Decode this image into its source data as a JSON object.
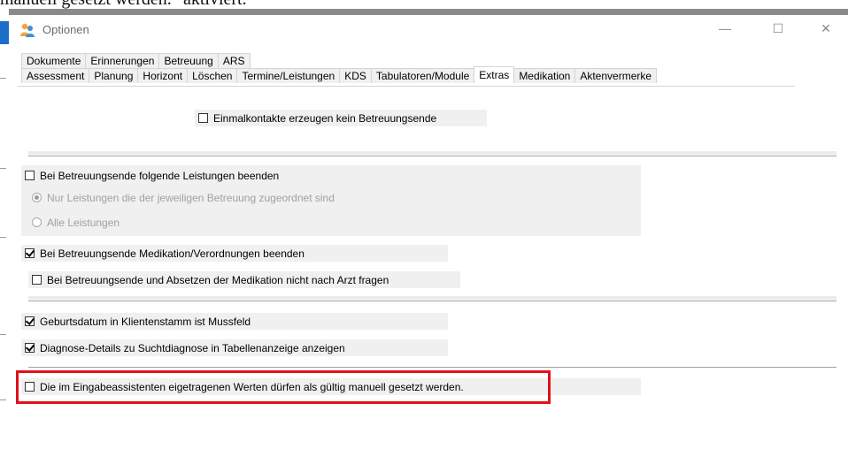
{
  "background": {
    "doc_text": "manuell gesetzt werden.\" aktiviert.",
    "accent_color": "#1c6fc9"
  },
  "window": {
    "title": "Optionen",
    "icon": "app-people-icon",
    "controls": {
      "minimize": "—",
      "maximize": "☐",
      "close": "✕"
    }
  },
  "tabs": {
    "row1": [
      "Dokumente",
      "Erinnerungen",
      "Betreuung",
      "ARS"
    ],
    "row2": [
      "Assessment",
      "Planung",
      "Horizont",
      "Löschen",
      "Termine/Leistungen",
      "KDS",
      "Tabulatoren/Module",
      "Extras",
      "Medikation",
      "Aktenvermerke"
    ],
    "active": "Extras"
  },
  "options": {
    "einmalkontakte": {
      "label": "Einmalkontakte erzeugen kein Betreuungsende",
      "checked": false
    },
    "leistungen_beenden": {
      "label": "Bei Betreuungsende folgende Leistungen beenden",
      "checked": false
    },
    "radio_nur": {
      "label": "Nur Leistungen die der jeweiligen Betreuung zugeordnet sind",
      "checked": true,
      "enabled": false
    },
    "radio_alle": {
      "label": "Alle Leistungen",
      "checked": false,
      "enabled": false
    },
    "medikation_beenden": {
      "label": "Bei Betreuungsende Medikation/Verordnungen beenden",
      "checked": true
    },
    "arzt_fragen": {
      "label": "Bei Betreuungsende und Absetzen der Medikation nicht nach Arzt fragen",
      "checked": false
    },
    "geburtsdatum": {
      "label": "Geburtsdatum in Klientenstamm ist Mussfeld",
      "checked": true
    },
    "diagnose": {
      "label": "Diagnose-Details zu Suchtdiagnose in Tabellenanzeige anzeigen",
      "checked": true
    },
    "eingabeassistent": {
      "label": "Die im Eingabeassistenten eigetragenen Werten dürfen als gültig manuell gesetzt werden.",
      "checked": false
    }
  },
  "highlight_color": "#e0111a"
}
